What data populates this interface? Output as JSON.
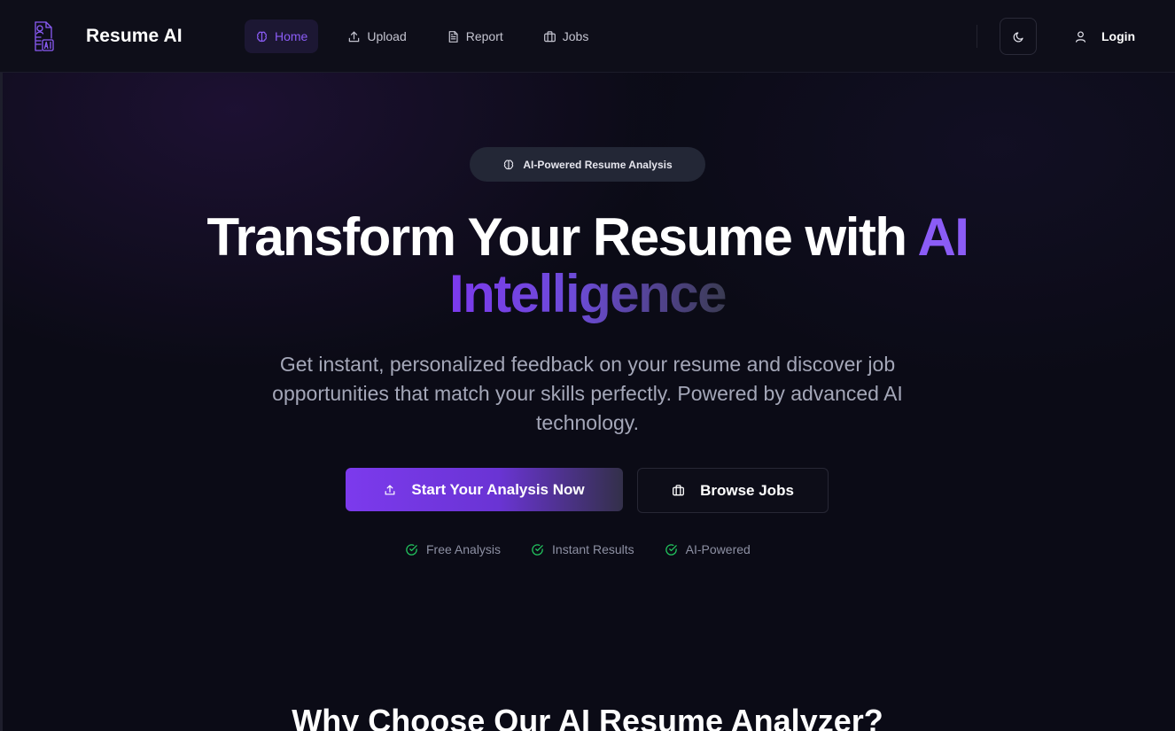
{
  "nav": {
    "brand": "Resume AI",
    "links": [
      {
        "label": "Home",
        "icon": "brain-icon",
        "active": true
      },
      {
        "label": "Upload",
        "icon": "upload-icon",
        "active": false
      },
      {
        "label": "Report",
        "icon": "document-icon",
        "active": false
      },
      {
        "label": "Jobs",
        "icon": "briefcase-icon",
        "active": false
      }
    ],
    "theme_icon": "moon-icon",
    "login_label": "Login"
  },
  "hero": {
    "badge": "AI-Powered Resume Analysis",
    "title_part1": "Transform Your Resume with ",
    "title_accent": "AI",
    "title_line2": "Intelligence",
    "subtitle": "Get instant, personalized feedback on your resume and discover job opportunities that match your skills perfectly. Powered by advanced AI technology.",
    "primary_cta": "Start Your Analysis Now",
    "secondary_cta": "Browse Jobs",
    "features": [
      "Free Analysis",
      "Instant Results",
      "AI-Powered"
    ]
  },
  "section": {
    "title": "Why Choose Our AI Resume Analyzer?"
  },
  "colors": {
    "accent": "#8b5cf6",
    "background": "#0b0b16",
    "success": "#22c55e"
  }
}
